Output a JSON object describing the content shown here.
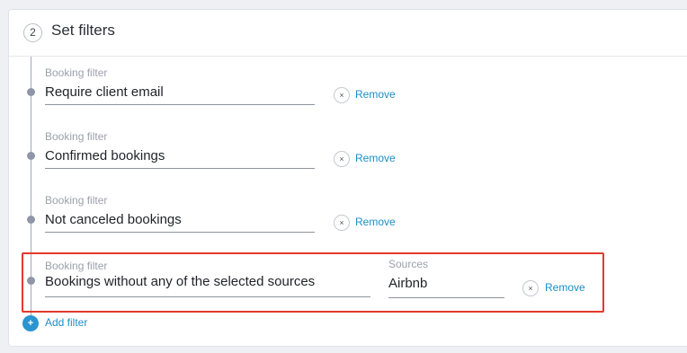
{
  "step": {
    "number": "2",
    "title": "Set filters"
  },
  "filters": [
    {
      "label": "Booking filter",
      "value": "Require client email",
      "remove_label": "Remove",
      "remove_icon": "×"
    },
    {
      "label": "Booking filter",
      "value": "Confirmed bookings",
      "remove_label": "Remove",
      "remove_icon": "×"
    },
    {
      "label": "Booking filter",
      "value": "Not canceled bookings",
      "remove_label": "Remove",
      "remove_icon": "×"
    },
    {
      "label": "Booking filter",
      "value": "Bookings without any of the selected sources",
      "remove_label": "Remove",
      "remove_icon": "×",
      "sources_label": "Sources",
      "sources_value": "Airbnb"
    }
  ],
  "add_filter": {
    "icon": "+",
    "label": "Add filter"
  },
  "colors": {
    "link": "#1a8fc6",
    "highlight": "#e23a2c",
    "add_button": "#2a95cf"
  }
}
